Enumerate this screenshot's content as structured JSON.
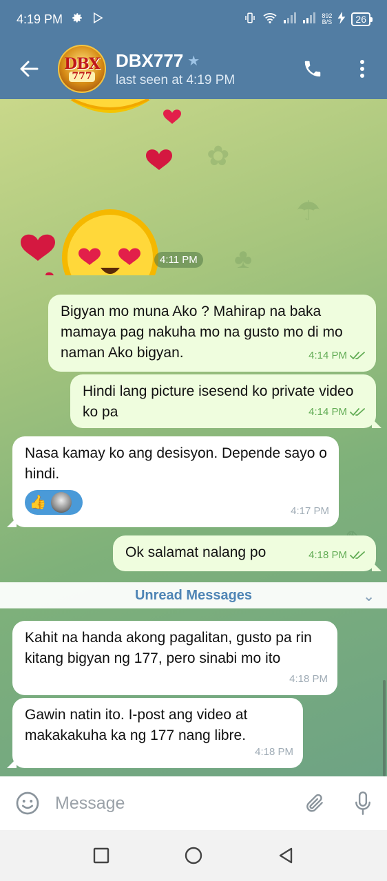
{
  "status_bar": {
    "time": "4:19 PM",
    "speed_value": "892",
    "speed_unit": "B/S",
    "battery": "26"
  },
  "header": {
    "avatar_text_top": "DBX",
    "avatar_text_bottom": "777",
    "name": "DBX777",
    "status": "last seen at 4:19 PM"
  },
  "sticker": {
    "time": "4:11 PM"
  },
  "messages": [
    {
      "direction": "out",
      "text": "Bigyan mo muna Ako ? Mahirap na baka mamaya pag nakuha mo na gusto mo di mo naman Ako bigyan.",
      "time": "4:14 PM"
    },
    {
      "direction": "out",
      "text": "Hindi lang picture isesend ko private video ko pa",
      "time": "4:14 PM"
    },
    {
      "direction": "in",
      "text": "Nasa kamay ko ang desisyon. Depende sayo o hindi.",
      "time": "4:17 PM",
      "reactions": [
        "thumbs-up",
        "user-avatar"
      ]
    },
    {
      "direction": "out",
      "text": "Ok salamat nalang po",
      "time": "4:18 PM"
    },
    {
      "direction": "in",
      "text": "Kahit na handa akong pagalitan, gusto pa rin kitang bigyan ng 177, pero sinabi mo ito",
      "time": "4:18 PM"
    },
    {
      "direction": "in",
      "text": "Gawin natin ito. I-post ang video at makakakuha ka ng 177 nang libre.",
      "time": "4:18 PM"
    }
  ],
  "unread_label": "Unread Messages",
  "input": {
    "placeholder": "Message"
  },
  "colors": {
    "header": "#527da3",
    "outgoing_bubble": "#effdde",
    "incoming_bubble": "#ffffff",
    "check_color": "#62ac55"
  }
}
